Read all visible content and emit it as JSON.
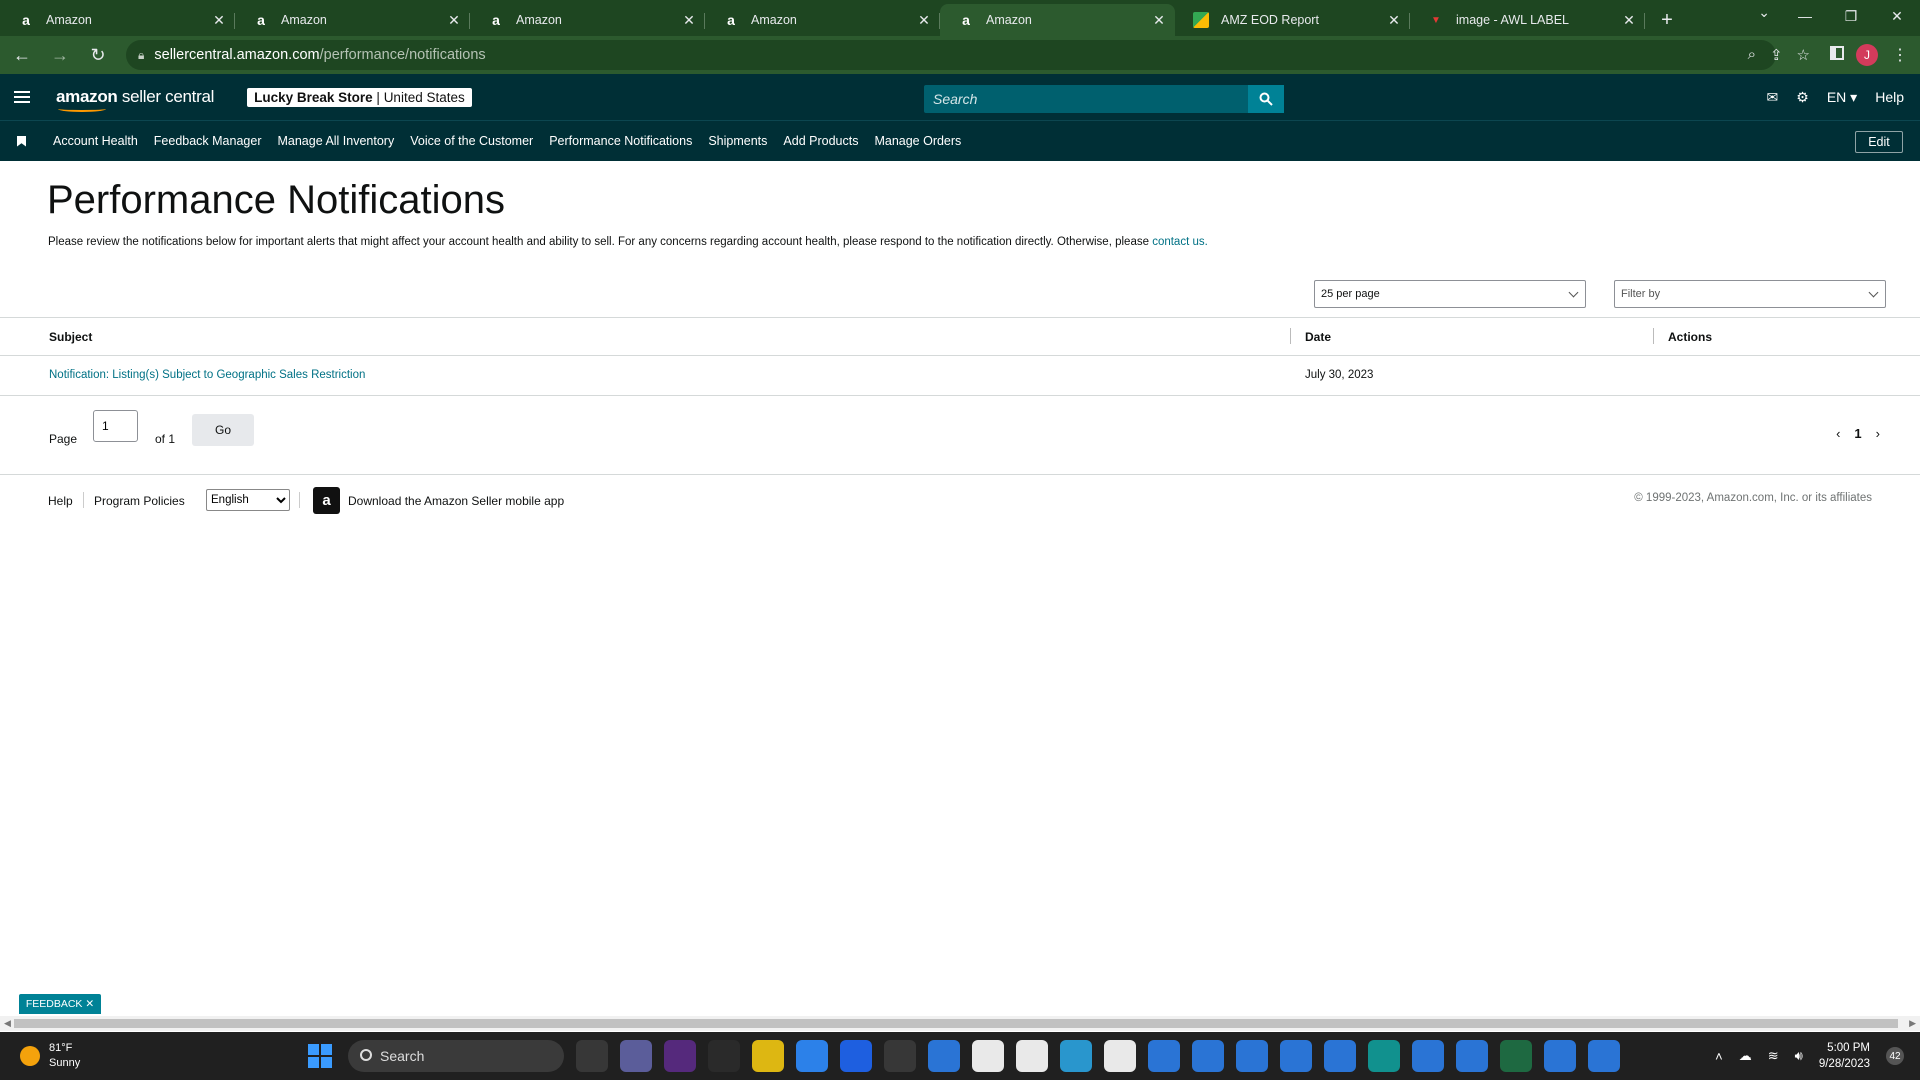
{
  "browser": {
    "tabs": [
      {
        "title": "Amazon",
        "icon": "amazon-icon",
        "active": false
      },
      {
        "title": "Amazon",
        "icon": "amazon-icon",
        "active": false
      },
      {
        "title": "Amazon",
        "icon": "amazon-icon",
        "active": false
      },
      {
        "title": "Amazon",
        "icon": "amazon-icon",
        "active": false
      },
      {
        "title": "Amazon",
        "icon": "amazon-icon",
        "active": true
      },
      {
        "title": "AMZ EOD Report",
        "icon": "google-sheets-icon",
        "active": false
      },
      {
        "title": "image - AWL LABEL",
        "icon": "label-icon",
        "active": false
      }
    ],
    "url_host": "sellercentral.amazon.com",
    "url_path": "/performance/notifications",
    "profile_initial": "J"
  },
  "header": {
    "logo_bold": "amazon",
    "logo_rest": " seller central",
    "store_name": "Lucky Break Store",
    "store_region": "United States",
    "search_placeholder": "Search",
    "language": "EN",
    "help": "Help"
  },
  "nav": {
    "links": [
      "Account Health",
      "Feedback Manager",
      "Manage All Inventory",
      "Voice of the Customer",
      "Performance Notifications",
      "Shipments",
      "Add Products",
      "Manage Orders"
    ],
    "edit": "Edit"
  },
  "page": {
    "title": "Performance Notifications",
    "intro_text": "Please review the notifications below for important alerts that might affect your account health and ability to sell. For any concerns regarding account health, please respond to the notification directly. Otherwise, please ",
    "intro_link": "contact us.",
    "per_page": "25 per page",
    "filter_placeholder": "Filter by"
  },
  "table": {
    "headers": {
      "subject": "Subject",
      "date": "Date",
      "actions": "Actions"
    },
    "rows": [
      {
        "subject": "Notification: Listing(s) Subject to Geographic Sales Restriction",
        "date": "July 30, 2023"
      }
    ]
  },
  "pagination": {
    "page_label": "Page",
    "current_page": "1",
    "of_label": "of 1",
    "go": "Go",
    "page_number": "1"
  },
  "footer": {
    "help": "Help",
    "program_policies": "Program Policies",
    "language": "English",
    "download_app": "Download the Amazon Seller mobile app",
    "copyright": "© 1999-2023, Amazon.com, Inc. or its affiliates"
  },
  "feedback": "FEEDBACK",
  "taskbar": {
    "weather_temp": "81°F",
    "weather_desc": "Sunny",
    "search": "Search",
    "time": "5:00 PM",
    "date": "9/28/2023",
    "notification_count": "42"
  },
  "colors": {
    "header_bg": "#002f36",
    "chrome_frame": "#1e4621",
    "link": "#007185",
    "search_btn": "#008296"
  }
}
